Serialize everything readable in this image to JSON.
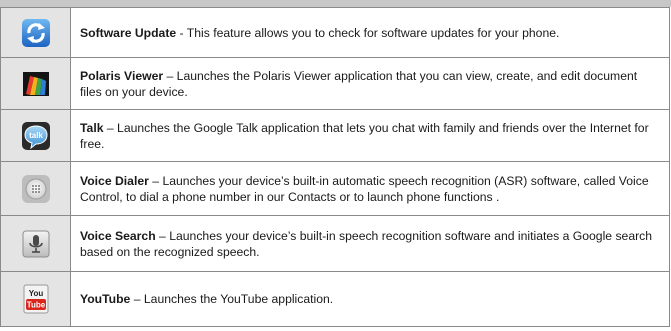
{
  "rows": [
    {
      "name": "Software Update",
      "separator": " - ",
      "description": "This feature allows you to check for software updates for your phone.",
      "icon": "software-update-icon"
    },
    {
      "name": "Polaris Viewer",
      "separator": " – ",
      "description": "Launches the Polaris Viewer application that you can view, create, and edit document files on your device.",
      "icon": "polaris-viewer-icon"
    },
    {
      "name": "Talk",
      "separator": " – ",
      "description": "Launches the Google Talk application that lets you chat with family and friends over the Internet for free.",
      "icon": "talk-icon",
      "icon_text": "talk"
    },
    {
      "name": "Voice Dialer",
      "separator": " – ",
      "description": "Launches your device’s built-in automatic speech recognition (ASR) software, called Voice Control, to dial a phone number in our Contacts or to launch phone functions .",
      "icon": "voice-dialer-icon"
    },
    {
      "name": "Voice Search",
      "separator": " – ",
      "description": "Launches your device’s built-in speech recognition software and initiates a Google search based on the recognized speech.",
      "icon": "voice-search-icon"
    },
    {
      "name": "YouTube",
      "separator": " – ",
      "description": "Launches the YouTube application.",
      "icon": "youtube-icon",
      "icon_text_top": "You",
      "icon_text_bottom": "Tube"
    }
  ]
}
